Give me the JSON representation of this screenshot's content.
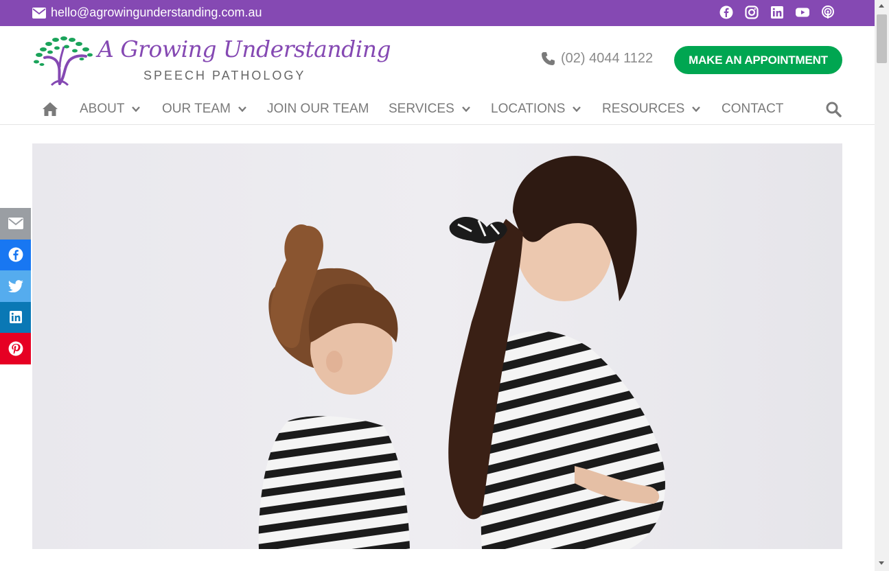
{
  "topbar": {
    "email": "hello@agrowingunderstanding.com.au",
    "background": "#8549b3",
    "social_icons": [
      "facebook-icon",
      "instagram-icon",
      "linkedin-icon",
      "youtube-icon",
      "podcast-icon"
    ]
  },
  "header": {
    "logo_title": "A Growing Understanding",
    "logo_subtitle": "SPEECH PATHOLOGY",
    "phone": "(02) 4044 1122",
    "appointment_button": "MAKE AN APPOINTMENT",
    "accent_green": "#00a651",
    "brand_purple": "#8549b3"
  },
  "nav": {
    "items": [
      {
        "label": "ABOUT",
        "dropdown": true
      },
      {
        "label": "OUR TEAM",
        "dropdown": true
      },
      {
        "label": "JOIN OUR TEAM",
        "dropdown": false
      },
      {
        "label": "SERVICES",
        "dropdown": true
      },
      {
        "label": "LOCATIONS",
        "dropdown": true
      },
      {
        "label": "RESOURCES",
        "dropdown": true
      },
      {
        "label": "CONTACT",
        "dropdown": false
      }
    ]
  },
  "share_bar": {
    "buttons": [
      {
        "icon": "email-icon",
        "color": "#9a9ea3"
      },
      {
        "icon": "facebook-icon",
        "color": "#1877f2"
      },
      {
        "icon": "twitter-icon",
        "color": "#55acee"
      },
      {
        "icon": "linkedin-icon",
        "color": "#0a78b5"
      },
      {
        "icon": "pinterest-icon",
        "color": "#e60023"
      }
    ]
  }
}
